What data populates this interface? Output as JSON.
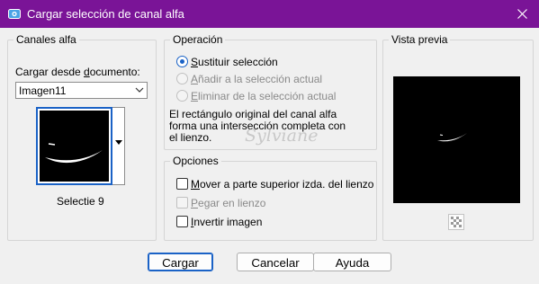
{
  "window": {
    "title": "Cargar selección de canal alfa"
  },
  "alpha_channels": {
    "legend": "Canales alfa",
    "load_from_label": "Cargar desde documento:",
    "document_value": "Imagen11",
    "selected_channel": "Selectie 9"
  },
  "operation": {
    "legend": "Operación",
    "options": [
      {
        "label": "Sustituir selección",
        "selected": true,
        "enabled": true
      },
      {
        "label": "Añadir a la selección actual",
        "selected": false,
        "enabled": false
      },
      {
        "label": "Eliminar de la selección actual",
        "selected": false,
        "enabled": false
      }
    ],
    "description_lines": [
      "El rectángulo original del canal alfa",
      "forma una intersección completa con",
      "el lienzo."
    ]
  },
  "options": {
    "legend": "Opciones",
    "checkboxes": [
      {
        "label": "Mover a parte superior izda. del lienzo",
        "checked": false,
        "enabled": true
      },
      {
        "label": "Pegar en lienzo",
        "checked": false,
        "enabled": false
      },
      {
        "label": "Invertir imagen",
        "checked": false,
        "enabled": true
      }
    ]
  },
  "preview": {
    "legend": "Vista previa"
  },
  "buttons": {
    "load": "Cargar",
    "cancel": "Cancelar",
    "help": "Ayuda"
  },
  "watermark": "Sylviane",
  "colors": {
    "titlebar": "#7a1497",
    "accent": "#1a62c6",
    "dialog_bg": "#f0f0f0"
  }
}
